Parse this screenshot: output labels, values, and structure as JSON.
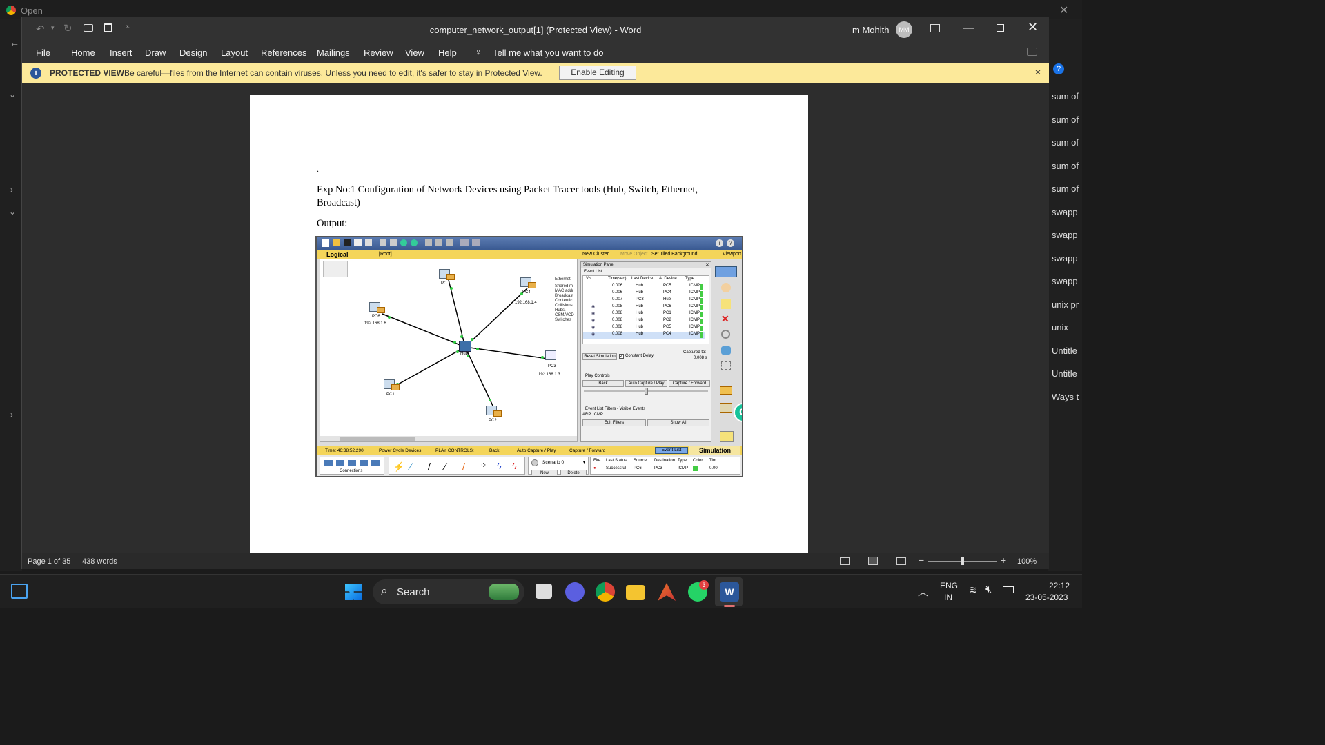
{
  "background": {
    "browser_tab": "Open",
    "right_list": [
      "sum of",
      "sum of",
      "sum of",
      "sum of",
      "sum of",
      "swapp",
      "swapp",
      "swapp",
      "swapp",
      "unix pr",
      "unix",
      "Untitle",
      "Untitle",
      "Ways t"
    ]
  },
  "word": {
    "title": "computer_network_output[1] (Protected View)  -  Word",
    "user_name": "m Mohith",
    "user_initials": "MM",
    "menu": [
      "File",
      "Home",
      "Insert",
      "Draw",
      "Design",
      "Layout",
      "References",
      "Mailings",
      "Review",
      "View",
      "Help"
    ],
    "tell_me": "Tell me what you want to do",
    "protected_view": {
      "label": "PROTECTED VIEW",
      "message": "Be careful—files from the Internet can contain viruses. Unless you need to edit, it's safer to stay in Protected View.",
      "button": "Enable Editing"
    },
    "document": {
      "dot": ".",
      "heading_line1": "Exp No:1 Configuration of Network Devices using Packet Tracer tools (Hub, Switch, Ethernet,",
      "heading_line2": "Broadcast)",
      "output_label": "Output:"
    },
    "status": {
      "page": "Page 1 of 35",
      "words": "438 words",
      "zoom": "100%"
    }
  },
  "packet_tracer": {
    "logical": "Logical",
    "root": "[Root]",
    "top_links": [
      "New Cluster",
      "Move Object",
      "Set Tiled Background",
      "Viewport"
    ],
    "devices": {
      "pc0": "PC",
      "pc4": "PC4",
      "pc4_ip": "192.168.1.4",
      "pc6": "PC6",
      "pc6_ip": "192.168.1.6",
      "hub": "Hub",
      "pc3": "PC3",
      "pc3_ip": "192.168.1.3",
      "pc1": "PC1",
      "pc2": "PC2"
    },
    "side_note": [
      "Ethernet",
      "Shared m",
      "MAC addr",
      "Broadcast",
      "Contentic",
      "Collisions,",
      "Hubs,",
      "CSMA/CD",
      "Switches"
    ],
    "sim_panel": {
      "title": "Simulation Panel",
      "event_list": "Event List",
      "headers": [
        "Vis.",
        "Time(sec)",
        "Last Device",
        "At Device",
        "Type"
      ],
      "rows": [
        [
          "",
          "0.006",
          "Hub",
          "PC5",
          "ICMP"
        ],
        [
          "",
          "0.006",
          "Hub",
          "PC4",
          "ICMP"
        ],
        [
          "",
          "0.007",
          "PC3",
          "Hub",
          "ICMP"
        ],
        [
          "eye",
          "0.008",
          "Hub",
          "PC6",
          "ICMP"
        ],
        [
          "eye",
          "0.008",
          "Hub",
          "PC1",
          "ICMP"
        ],
        [
          "eye",
          "0.008",
          "Hub",
          "PC2",
          "ICMP"
        ],
        [
          "eye",
          "0.008",
          "Hub",
          "PC5",
          "ICMP"
        ],
        [
          "eye",
          "0.008",
          "Hub",
          "PC4",
          "ICMP"
        ]
      ],
      "reset": "Reset Simulation",
      "constant_delay": "Constant Delay",
      "captured_to": "Captured to:",
      "captured_val": "0.008 s",
      "play_controls": "Play Controls",
      "back": "Back",
      "auto": "Auto Capture / Play",
      "capture_fwd": "Capture / Forward",
      "filters_title": "Event List Filters - Visible Events",
      "filters_val": "ARP, ICMP",
      "edit_filters": "Edit Filters",
      "show_all": "Show All"
    },
    "bottom_bar": {
      "time": "Time: 46:38:52.290",
      "power": "Power Cycle Devices",
      "play": "PLAY CONTROLS:",
      "back": "Back",
      "auto": "Auto Capture / Play",
      "capture": "Capture / Forward",
      "event_list": "Event List",
      "simulation": "Simulation"
    },
    "scenario": {
      "name": "Scenario 0",
      "new": "New",
      "delete": "Delete",
      "connections": "Connections",
      "headers": [
        "Fire",
        "Last Status",
        "Source",
        "Destination",
        "Type",
        "Color",
        "Tim"
      ],
      "row": [
        "",
        "Successful",
        "PC6",
        "PC3",
        "ICMP",
        "",
        "0.00"
      ]
    }
  },
  "taskbar": {
    "search": "Search",
    "lang1": "ENG",
    "lang2": "IN",
    "time": "22:12",
    "date": "23-05-2023",
    "whatsapp_badge": "3"
  },
  "colors": {
    "pv_bar": "#fce99a",
    "word_blue": "#2b579a",
    "accent": "#0078d4"
  }
}
